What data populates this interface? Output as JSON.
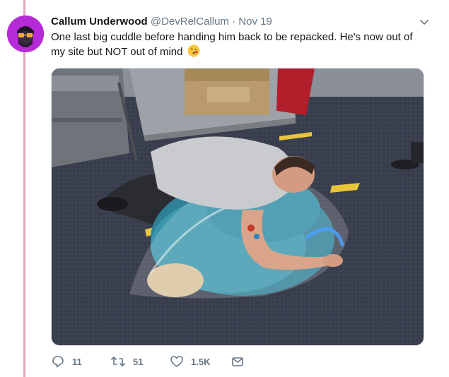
{
  "tweet": {
    "display_name": "Callum Underwood",
    "handle": "@DevRelCallum",
    "separator": "·",
    "date": "Nov 19",
    "text": "One last big cuddle before handing him back to be repacked. He's now out of my site but NOT out of mind",
    "emoji": "kissing-face-emoji",
    "photo_alt": "",
    "counts": {
      "replies": "11",
      "retweets": "51",
      "likes": "1.5K"
    }
  },
  "icons": {
    "reply": "reply-icon",
    "retweet": "retweet-icon",
    "like": "heart-icon",
    "dm": "envelope-icon",
    "more": "chevron-down-icon"
  },
  "colors": {
    "thread_line": "#e0a6c2",
    "text_secondary": "#657786",
    "avatar_bg": "#c22ad8"
  }
}
